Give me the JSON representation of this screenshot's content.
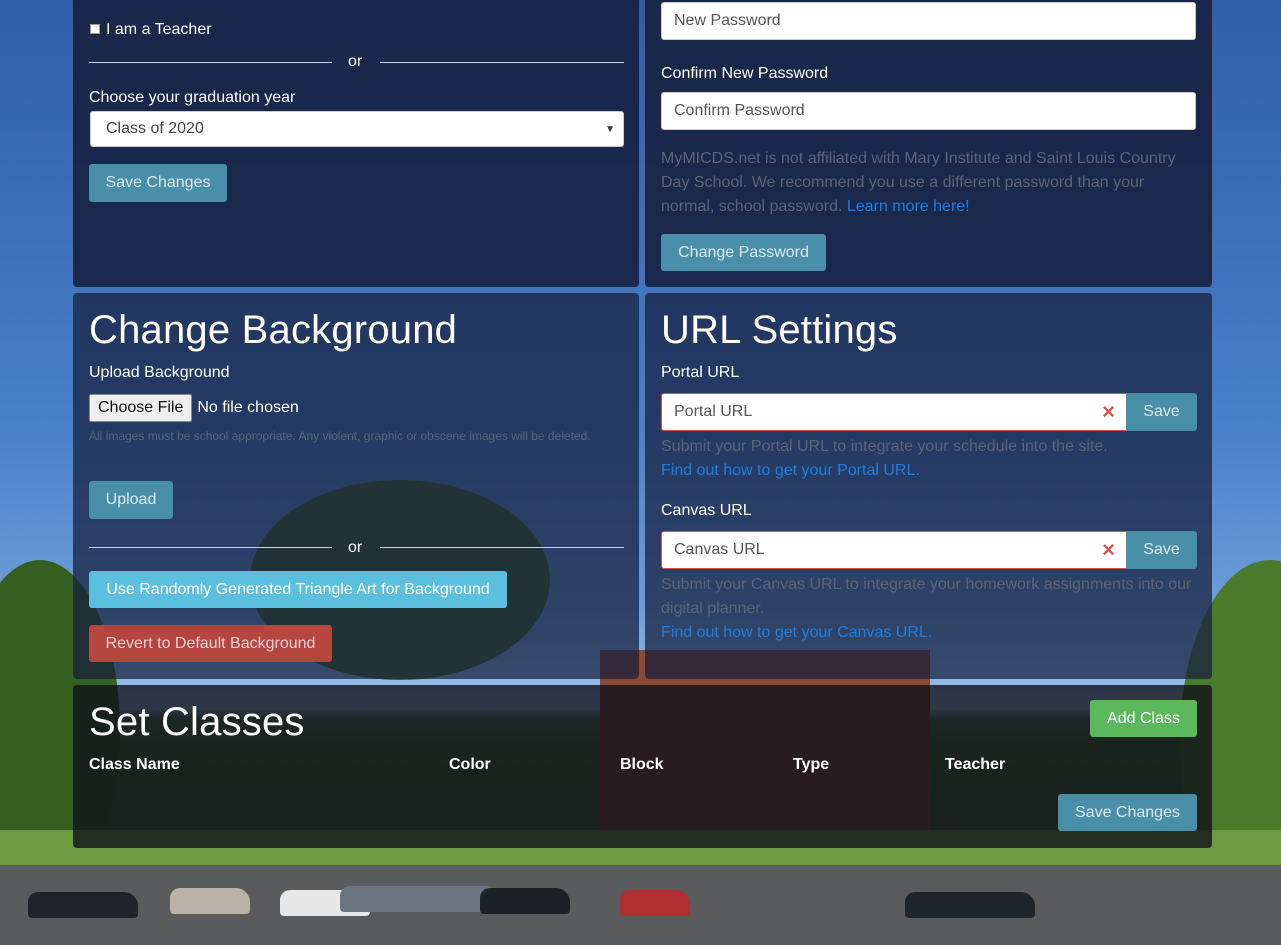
{
  "colors": {
    "panel": "#182244",
    "btn_info": "#4a8fa8",
    "btn_cyan": "#5bc0de",
    "btn_red": "#b5463f",
    "btn_green": "#5cb85c",
    "link": "#1e7fe0"
  },
  "grade_panel": {
    "teacher_checkbox_label": "I am a Teacher",
    "or_text": "or",
    "grad_year_label": "Choose your graduation year",
    "grad_year_selected": "Class of 2020",
    "save_label": "Save Changes"
  },
  "password_panel": {
    "new_password_placeholder": "New Password",
    "confirm_label": "Confirm New Password",
    "confirm_placeholder": "Confirm Password",
    "disclaimer": "MyMICDS.net is not affiliated with Mary Institute and Saint Louis Country Day School. We recommend you use a different password than your normal, school password.",
    "learn_more_link": "Learn more here!",
    "change_label": "Change Password"
  },
  "background_panel": {
    "title": "Change Background",
    "upload_label": "Upload Background",
    "choose_file_label": "Choose File",
    "no_file_text": "No file chosen",
    "upload_help": "All images must be school appropriate. Any violent, graphic or obscene images will be deleted.",
    "upload_button": "Upload",
    "or_text": "or",
    "triangle_art_button": "Use Randomly Generated Triangle Art for Background",
    "revert_button": "Revert to Default Background"
  },
  "url_panel": {
    "title": "URL Settings",
    "portal_label": "Portal URL",
    "portal_placeholder": "Portal URL",
    "portal_save": "Save",
    "portal_help": "Submit your Portal URL to integrate your schedule into the site.",
    "portal_link": "Find out how to get your Portal URL.",
    "canvas_label": "Canvas URL",
    "canvas_placeholder": "Canvas URL",
    "canvas_save": "Save",
    "canvas_help": "Submit your Canvas URL to integrate your homework assignments into our digital planner.",
    "canvas_link": "Find out how to get your Canvas URL.",
    "clear_icon": "×"
  },
  "classes_panel": {
    "title": "Set Classes",
    "add_class": "Add Class",
    "columns": [
      "Class Name",
      "Color",
      "Block",
      "Type",
      "Teacher"
    ],
    "save_label": "Save Changes"
  }
}
